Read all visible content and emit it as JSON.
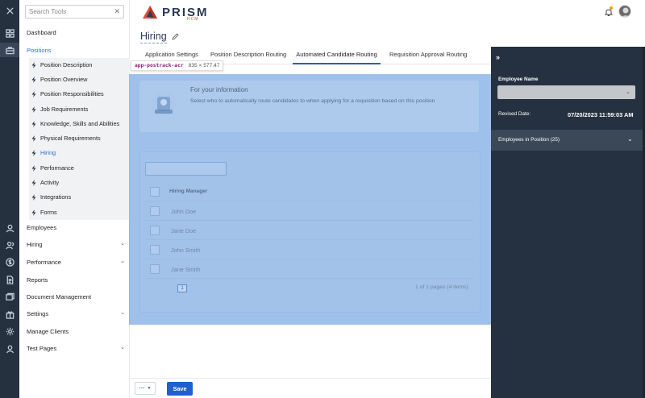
{
  "app": {
    "logo_text": "PRISM",
    "logo_sub": "HCM"
  },
  "colors": {
    "rail_bg": "#263140",
    "accent_blue": "#2e6fc9",
    "save_button": "#1f5fd0",
    "right_panel_bg": "#253140",
    "highlight_overlay": "#6b9ede"
  },
  "rail": {
    "icons": [
      "close-icon",
      "dashboard-icon",
      "briefcase-icon",
      "user-icon",
      "users-icon",
      "dollar-icon",
      "document-icon",
      "folder-icon",
      "gift-icon",
      "gear-icon",
      "person-icon"
    ]
  },
  "tools": {
    "search_placeholder": "Search Tools",
    "clear_glyph": "✕",
    "dashboard": "Dashboard",
    "positions": "Positions",
    "position_items": [
      "Position Description",
      "Position Overview",
      "Position Responsibilities",
      "Job Requirements",
      "Knowledge, Skills and Abilities",
      "Physical Requirements",
      "Hiring",
      "Performance",
      "Activity",
      "Integrations",
      "Forms"
    ],
    "employees": "Employees",
    "hiring": "Hiring",
    "performance": "Performance",
    "reports": "Reports",
    "document_management": "Document Management",
    "settings": "Settings",
    "manage_clients": "Manage Clients",
    "test_pages": "Test Pages"
  },
  "page": {
    "title": "Hiring",
    "tabs": [
      "Application Settings",
      "Position Description Routing",
      "Automated Candidate Routing",
      "Requisition Approval Routing"
    ],
    "active_tab": "Automated Candidate Routing"
  },
  "tooltip": {
    "component": "app-postrack-acr",
    "dimensions": "835 × 577.47"
  },
  "info": {
    "title": "For your information",
    "text": "Select who to automatically route candidates to when applying for a requisition based on this position"
  },
  "grid": {
    "column_header": "Hiring Manager",
    "rows": [
      "John Doe",
      "Jane Doe",
      "John Smith",
      "Jane Smith"
    ],
    "page_number": "1",
    "pager_info": "1 of 1 pages (4 items)"
  },
  "right_panel": {
    "toggle_glyph": "»",
    "employee_name_label": "Employee Name",
    "revised_date_label": "Revised Date:",
    "revised_date_value": "07/20/2023 11:59:03 AM",
    "employees_in_position": "Employees in Position (25)"
  },
  "footer": {
    "more_label": "···",
    "save_label": "Save"
  }
}
